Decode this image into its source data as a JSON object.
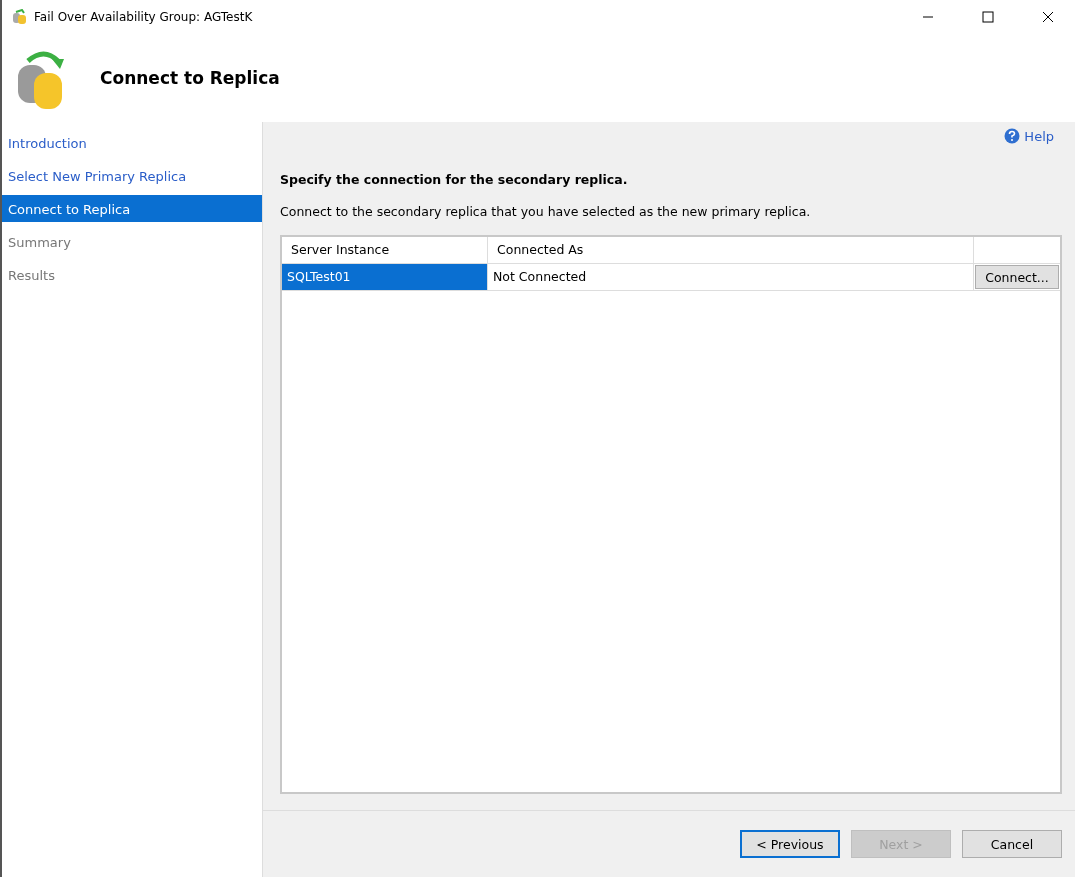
{
  "window": {
    "title": "Fail Over Availability Group: AGTestK"
  },
  "header": {
    "title": "Connect to Replica"
  },
  "sidebar": {
    "items": [
      {
        "label": "Introduction",
        "selected": false,
        "disabled": false
      },
      {
        "label": "Select New Primary Replica",
        "selected": false,
        "disabled": false
      },
      {
        "label": "Connect to Replica",
        "selected": true,
        "disabled": false
      },
      {
        "label": "Summary",
        "selected": false,
        "disabled": true
      },
      {
        "label": "Results",
        "selected": false,
        "disabled": true
      }
    ]
  },
  "help": "Help",
  "heading": "Specify the connection for the secondary replica.",
  "description": "Connect to the secondary replica that you have selected as the new primary replica.",
  "table": {
    "columns": [
      "Server Instance",
      "Connected As"
    ],
    "rows": [
      {
        "server": "SQLTest01",
        "connected_as": "Not Connected",
        "action": "Connect...",
        "selected": true
      }
    ]
  },
  "buttons": [
    {
      "label": "< Previous",
      "disabled": false,
      "focused": true
    },
    {
      "label": "Next >",
      "disabled": true,
      "focused": false
    },
    {
      "label": "Cancel",
      "disabled": false,
      "focused": false
    }
  ]
}
